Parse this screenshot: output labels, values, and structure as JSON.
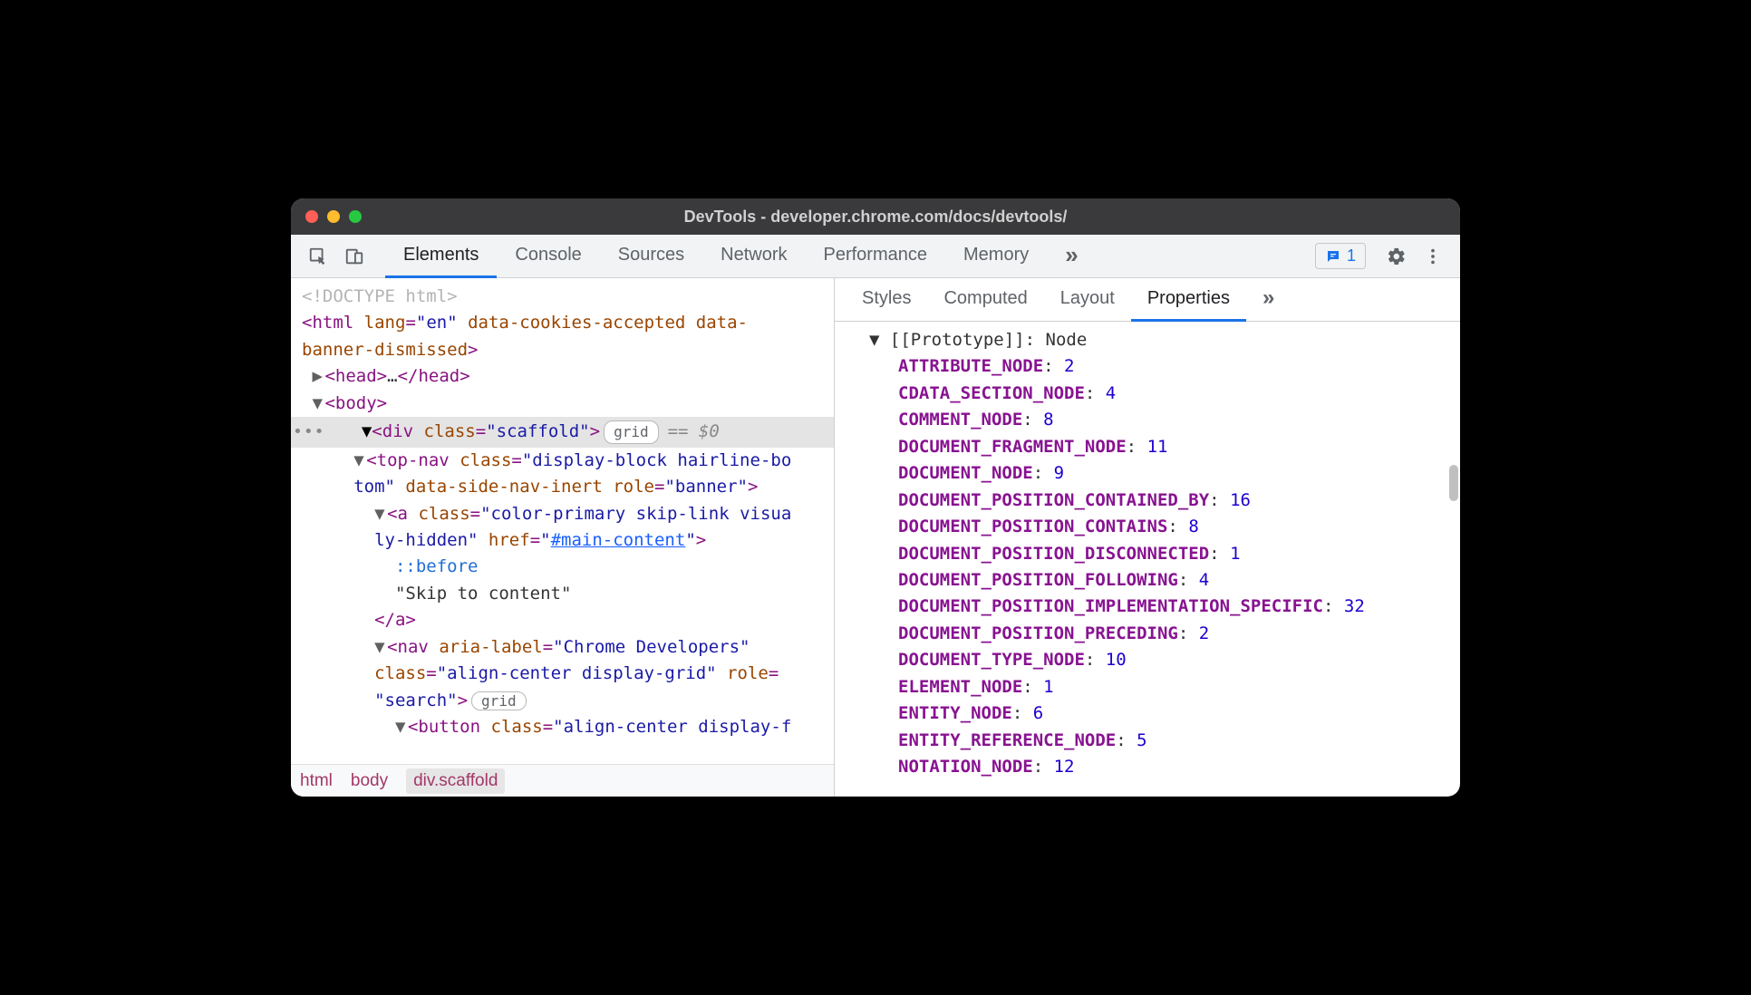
{
  "window": {
    "title": "DevTools - developer.chrome.com/docs/devtools/"
  },
  "mainTabs": {
    "items": [
      "Elements",
      "Console",
      "Sources",
      "Network",
      "Performance",
      "Memory"
    ],
    "activeIndex": 0,
    "issuesCount": "1"
  },
  "dom": {
    "doctype": "<!DOCTYPE html>",
    "htmlOpen": {
      "tag": "html",
      "attrs": "lang=\"en\" data-cookies-accepted data-banner-dismissed"
    },
    "headCollapsed": {
      "open": "<head>",
      "ellipsis": "…",
      "close": "</head>"
    },
    "bodyOpen": "<body>",
    "selected": {
      "tag": "div",
      "class": "scaffold",
      "pill": "grid",
      "suffix": "== $0"
    },
    "topnav": {
      "tag": "top-nav",
      "attrs1": "class=\"display-block hairline-bo",
      "attrs2": "tom\" data-side-nav-inert role=\"banner\""
    },
    "alink": {
      "tag": "a",
      "attrs1": "class=\"color-primary skip-link visua",
      "attrs2": "ly-hidden\" href=",
      "hrefval": "#main-content"
    },
    "pseudo": "::before",
    "skipText": "\"Skip to content\"",
    "aclose": "</a>",
    "nav": {
      "tag": "nav",
      "line1": "aria-label=\"Chrome Developers\"",
      "line2": "class=\"align-center display-grid\" role=",
      "line3": "\"search\"",
      "pill": "grid"
    },
    "button": {
      "tag": "button",
      "attrs": "class=\"align-center display-f"
    }
  },
  "crumbs": {
    "c1": "html",
    "c2": "body",
    "c3": "div.scaffold"
  },
  "subTabs": {
    "items": [
      "Styles",
      "Computed",
      "Layout",
      "Properties"
    ],
    "activeIndex": 3
  },
  "properties": {
    "prototype": {
      "label": "[[Prototype]]",
      "value": "Node"
    },
    "list": [
      {
        "key": "ATTRIBUTE_NODE",
        "value": "2"
      },
      {
        "key": "CDATA_SECTION_NODE",
        "value": "4"
      },
      {
        "key": "COMMENT_NODE",
        "value": "8"
      },
      {
        "key": "DOCUMENT_FRAGMENT_NODE",
        "value": "11"
      },
      {
        "key": "DOCUMENT_NODE",
        "value": "9"
      },
      {
        "key": "DOCUMENT_POSITION_CONTAINED_BY",
        "value": "16"
      },
      {
        "key": "DOCUMENT_POSITION_CONTAINS",
        "value": "8"
      },
      {
        "key": "DOCUMENT_POSITION_DISCONNECTED",
        "value": "1"
      },
      {
        "key": "DOCUMENT_POSITION_FOLLOWING",
        "value": "4"
      },
      {
        "key": "DOCUMENT_POSITION_IMPLEMENTATION_SPECIFIC",
        "value": "32"
      },
      {
        "key": "DOCUMENT_POSITION_PRECEDING",
        "value": "2"
      },
      {
        "key": "DOCUMENT_TYPE_NODE",
        "value": "10"
      },
      {
        "key": "ELEMENT_NODE",
        "value": "1"
      },
      {
        "key": "ENTITY_NODE",
        "value": "6"
      },
      {
        "key": "ENTITY_REFERENCE_NODE",
        "value": "5"
      },
      {
        "key": "NOTATION_NODE",
        "value": "12"
      }
    ]
  }
}
